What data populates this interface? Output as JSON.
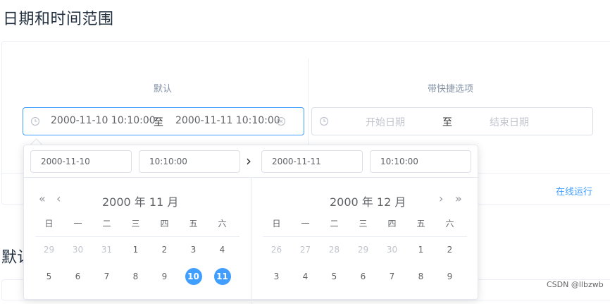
{
  "page": {
    "title": "日期和时间范围",
    "section2_title_partial": "默认"
  },
  "demo": {
    "default": {
      "caption": "默认",
      "start_value": "2000-11-10 10:10:00",
      "separator": "至",
      "end_value": "2000-11-11 10:10:00"
    },
    "shortcuts": {
      "caption": "带快捷选项",
      "start_placeholder": "开始日期",
      "separator": "至",
      "end_placeholder": "结束日期"
    },
    "run_online": "在线运行"
  },
  "picker": {
    "left_date": "2000-11-10",
    "left_time": "10:10:00",
    "right_date": "2000-11-11",
    "right_time": "10:10:00",
    "arrow": "›",
    "left_month": "2000 年 11 月",
    "right_month": "2000 年 12 月",
    "nav_prev_year": "«",
    "nav_prev_month": "‹",
    "nav_next_month": "›",
    "nav_next_year": "»",
    "weekdays": [
      "日",
      "一",
      "二",
      "三",
      "四",
      "五",
      "六"
    ],
    "left_rows": [
      [
        "29",
        "30",
        "31",
        "1",
        "2",
        "3",
        "4"
      ],
      [
        "5",
        "6",
        "7",
        "8",
        "9",
        "10",
        "11"
      ]
    ],
    "right_rows": [
      [
        "26",
        "27",
        "28",
        "29",
        "30",
        "1",
        "2"
      ],
      [
        "3",
        "4",
        "5",
        "6",
        "7",
        "8",
        "9"
      ]
    ]
  },
  "watermark": "CSDN @llbzwb",
  "colors": {
    "accent": "#409eff",
    "border": "#dcdfe6",
    "muted": "#c0c4cc"
  }
}
